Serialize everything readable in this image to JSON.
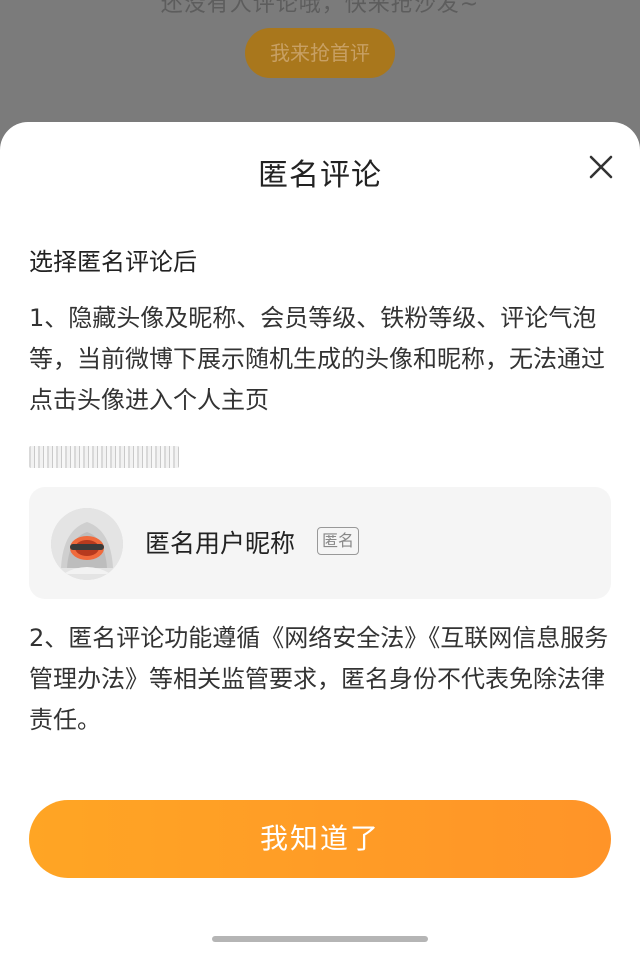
{
  "background": {
    "hint_text": "还没有人评论哦，快来抢沙发~",
    "first_comment_button": "我来抢首评"
  },
  "dialog": {
    "title": "匿名评论",
    "close_icon": "close-icon",
    "subheading": "选择匿名评论后",
    "paragraph1": "1、隐藏头像及昵称、会员等级、铁粉等级、评论气泡等，当前微博下展示随机生成的头像和昵称，无法通过点击头像进入个人主页",
    "preview": {
      "avatar_icon": "anonymous-avatar-icon",
      "nickname": "匿名用户昵称",
      "badge": "匿名"
    },
    "paragraph2": "2、匿名评论功能遵循《网络安全法》《互联网信息服务管理办法》等相关监管要求，匿名身份不代表免除法律责任。",
    "confirm_button": "我知道了"
  },
  "colors": {
    "accent": "#ff9d26",
    "overlay": "#7b7b7b"
  }
}
